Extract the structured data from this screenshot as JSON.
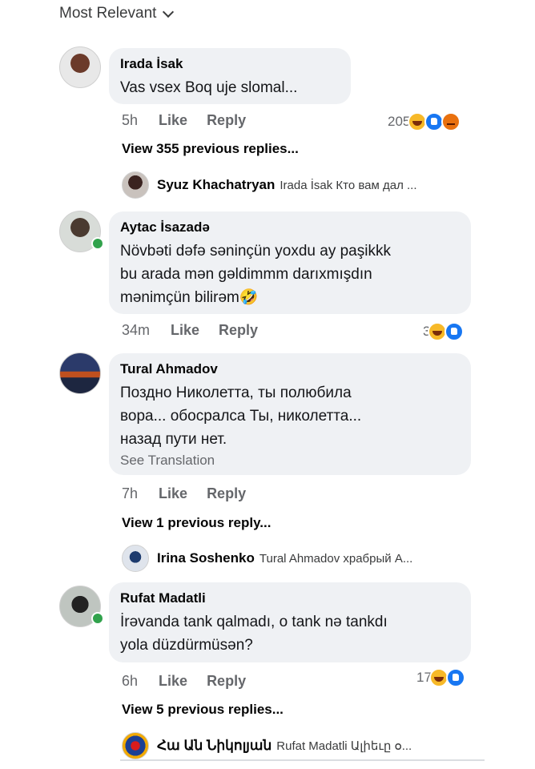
{
  "sort_label": "Most Relevant",
  "comments": [
    {
      "author": "Irada İsak",
      "text": "Vas vsex Boq uje slomal...",
      "time": "5h",
      "like": "Like",
      "reply": "Reply",
      "react_count": "205",
      "reactions": [
        "haha",
        "like",
        "angry"
      ],
      "view_more": "View 355 previous replies...",
      "last_reply": {
        "name": "Syuz Khachatryan",
        "text": "Irada İsak Кто вам дал ..."
      }
    },
    {
      "author": "Aytac İsazadə",
      "text": "Növbəti dəfə səninçün yoxdu ay paşikkk\nbu arada mən gəldimmm darıxmışdın\nmənimçün bilirəm🤣",
      "time": "34m",
      "like": "Like",
      "reply": "Reply",
      "react_count": "3",
      "reactions": [
        "haha",
        "like"
      ]
    },
    {
      "author": "Tural Ahmadov",
      "text": "Поздно Николетта, ты полюбила\nвора... обосралса   Ты, николетта...\nназад пути нет.",
      "see_translation": "See Translation",
      "time": "7h",
      "like": "Like",
      "reply": "Reply",
      "view_more": "View 1 previous reply...",
      "last_reply": {
        "name": "Irina Soshenko",
        "text": "Tural Ahmadov  храбрый А..."
      }
    },
    {
      "author": "Rufat Madatli",
      "text": "İrəvanda tank qalmadı, o tank nə tankdı\nyola düzdürmüsən?",
      "time": "6h",
      "like": "Like",
      "reply": "Reply",
      "react_count": "17",
      "reactions": [
        "haha",
        "like"
      ],
      "view_more": "View 5 previous replies...",
      "last_reply": {
        "name": "Հա Ան Նիկոլյան",
        "text": "Rufat Madatli Ալիեւը օ..."
      }
    }
  ]
}
